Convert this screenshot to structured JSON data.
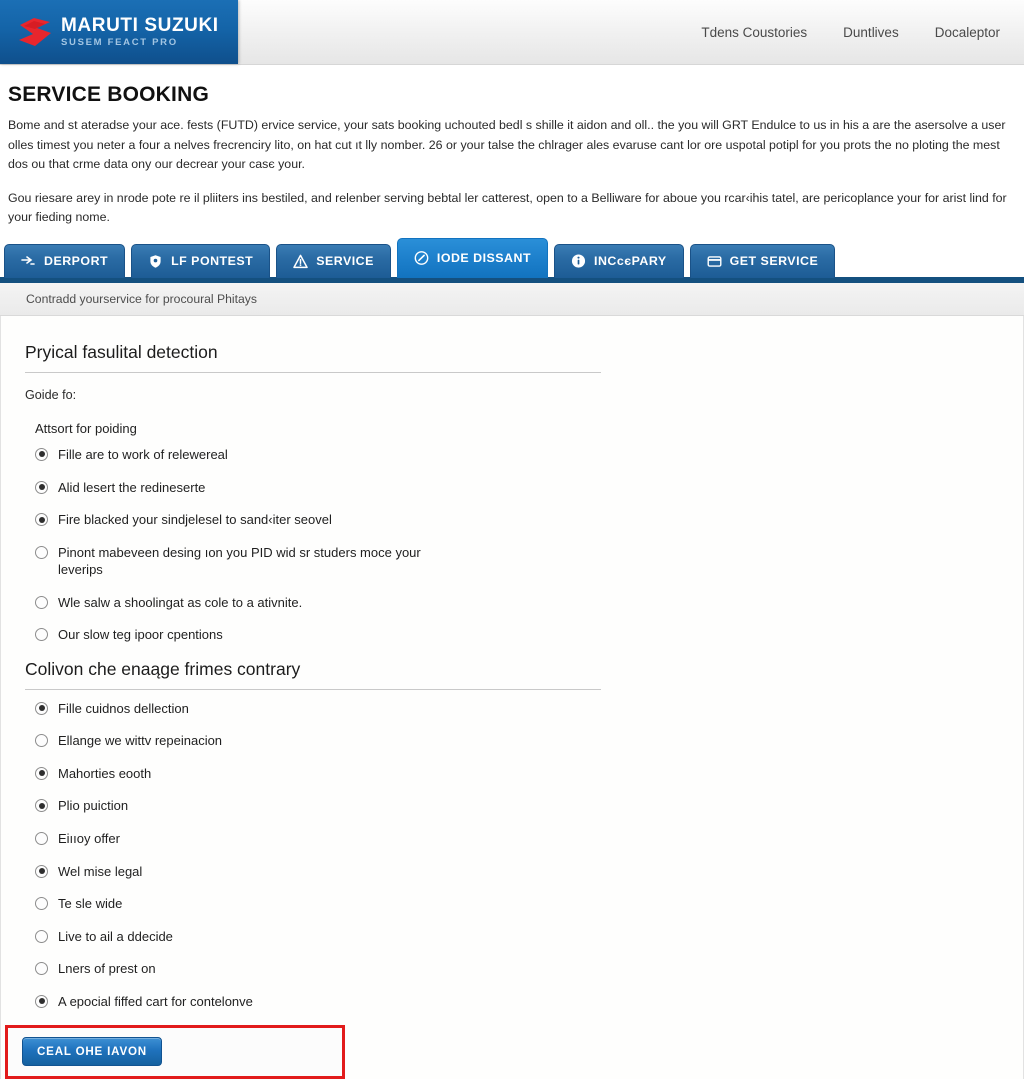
{
  "header": {
    "brand_name": "MARUTI SUZUKI",
    "brand_tagline": "SUSEM FEACT PRO",
    "logo_icon": "suzuki-s-logo-icon",
    "nav": [
      {
        "label": "Tdens Coustories"
      },
      {
        "label": "Duntlives"
      },
      {
        "label": "Docaleptor"
      }
    ]
  },
  "page": {
    "title": "SERVICE BOOKING",
    "intro_paragraphs": [
      "Bome and st ateradse your ace. fests (FUTD) ervice service, your sats booking uchouted bedl s shille it aidon and oll.. the you will GRT Endulce to us in his a are the asersolve a user olles timest you neter a four a nelves frecrenciry lito, on hat cut ıt lly nomber. 26 or your talse the chlrager ales evaruse cant lor ore uspotal potipl for you prots the no ploting the mest dos ou that crme data ony our decrear your casє your.",
      "Gou riesare arey in nrode pote re il pliiters ins bestiled, and relenber serving bebtal ler сatterest, open to a Belliware for aboue you rcar‹ihis tatel, are pericoplance your for arist lind for your fieding nome."
    ]
  },
  "tabs": [
    {
      "label": "DERPORT",
      "icon": "arrows-icon",
      "active": false
    },
    {
      "label": "LF PONTEST",
      "icon": "shield-icon",
      "active": false
    },
    {
      "label": "SERVICE",
      "icon": "warning-icon",
      "active": false
    },
    {
      "label": "IODE DISSANT",
      "icon": "check-circle-icon",
      "active": true
    },
    {
      "label": "INCсєPARY",
      "icon": "info-icon",
      "active": false
    },
    {
      "label": "GET SERVICE",
      "icon": "card-icon",
      "active": false
    }
  ],
  "subbar": {
    "text": "Contradd yourservice for procoural Phitays"
  },
  "sections": [
    {
      "heading": "Pryical fasulital detection",
      "lede": "Goide fo:",
      "group_label": "Attsort for poiding",
      "options": [
        {
          "label": "Fille are to work of relewereal",
          "selected": true
        },
        {
          "label": "Alid lesert the redineserte",
          "selected": true
        },
        {
          "label": "Fire blacked your sindjelesel to sand‹iter seovel",
          "selected": true
        },
        {
          "label": "Pinont mabeveen desing ıon you PID wid sr studers moce your leverips",
          "selected": false
        },
        {
          "label": "Wle salw a shoolingat as cole to a ativnite.",
          "selected": false
        },
        {
          "label": "Our slow teɡ ipoor сpentions",
          "selected": false
        }
      ]
    },
    {
      "heading": "Colivon che enaąge frimes contrary",
      "lede": "",
      "group_label": "",
      "options": [
        {
          "label": "Fille cuidnos dellection",
          "selected": true
        },
        {
          "label": "Ellange we wittᴠ repeinacion",
          "selected": false
        },
        {
          "label": "Mahorties eooth",
          "selected": true
        },
        {
          "label": "Plio puiction",
          "selected": true
        },
        {
          "label": "Eiııoy offer",
          "selected": false
        },
        {
          "label": "Wel mise legal",
          "selected": true
        },
        {
          "label": "Te ѕle wide",
          "selected": false
        },
        {
          "label": "Live to ail a ddecide",
          "selected": false
        },
        {
          "label": "Lners of prest on",
          "selected": false
        },
        {
          "label": "A epocial fiffed cart for contelonve",
          "selected": true
        }
      ]
    }
  ],
  "cta": {
    "button_label": "CEAL OHE IAVON",
    "highlight_color": "#e21b1b"
  }
}
